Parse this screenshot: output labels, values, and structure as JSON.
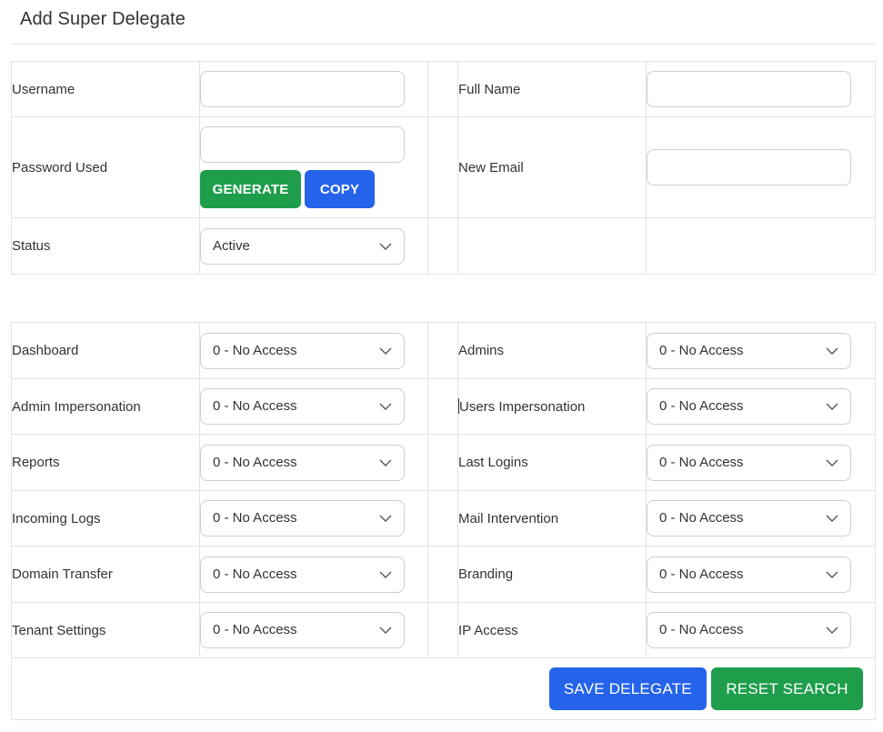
{
  "modal": {
    "title": "Add Super Delegate"
  },
  "account": {
    "username_label": "Username",
    "username_value": "",
    "fullname_label": "Full Name",
    "fullname_value": "",
    "password_label": "Password Used",
    "password_value": "",
    "generate_label": "GENERATE",
    "copy_label": "COPY",
    "new_email_label": "New Email",
    "new_email_value": "",
    "status_label": "Status",
    "status_value": "Active"
  },
  "permissions": [
    {
      "label": "Dashboard",
      "value": "0 - No Access"
    },
    {
      "label": "Admins",
      "value": "0 - No Access"
    },
    {
      "label": "Admin Impersonation",
      "value": "0 - No Access"
    },
    {
      "label": "Users Impersonation",
      "value": "0 - No Access"
    },
    {
      "label": "Reports",
      "value": "0 - No Access"
    },
    {
      "label": "Last Logins",
      "value": "0 - No Access"
    },
    {
      "label": "Incoming Logs",
      "value": "0 - No Access"
    },
    {
      "label": "Mail Intervention",
      "value": "0 - No Access"
    },
    {
      "label": "Domain Transfer",
      "value": "0 - No Access"
    },
    {
      "label": "Branding",
      "value": "0 - No Access"
    },
    {
      "label": "Tenant Settings",
      "value": "0 - No Access"
    },
    {
      "label": "IP Access",
      "value": "0 - No Access"
    }
  ],
  "footer": {
    "save_label": "SAVE DELEGATE",
    "reset_label": "RESET SEARCH"
  },
  "colors": {
    "primary_blue": "#2563eb",
    "success_green": "#1e9e4b",
    "border": "#e3e3e3"
  },
  "icons": {
    "select_arrow": "chevron-down-icon"
  }
}
